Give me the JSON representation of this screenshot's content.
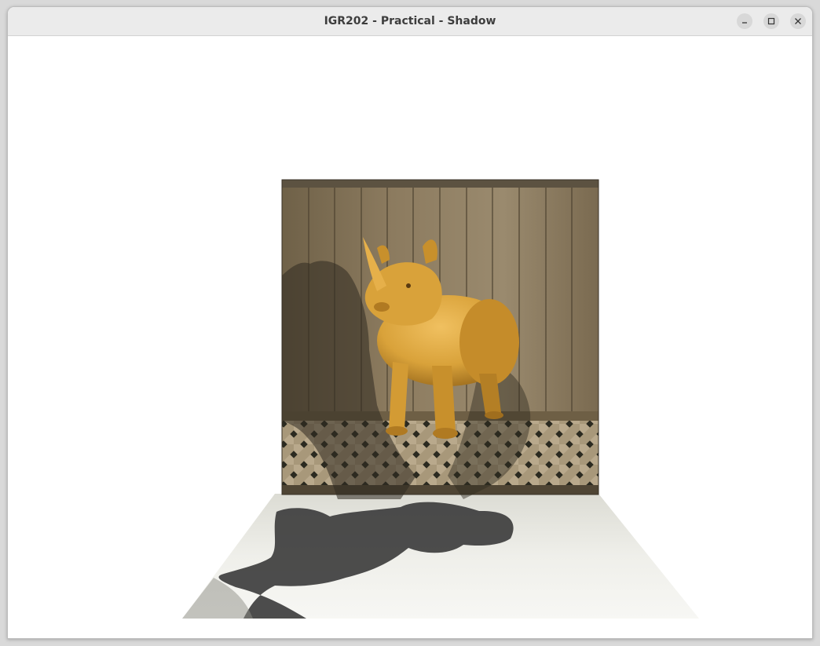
{
  "window": {
    "title": "IGR202 - Practical - Shadow",
    "controls": [
      "minimize",
      "maximize",
      "close"
    ]
  },
  "viewport": {
    "background": "#ffffff",
    "scene": {
      "objects": [
        "rhino-model",
        "wooden-fence-wall",
        "floor-plane",
        "rhino-shadow"
      ],
      "rhino_color": "#d9a23a",
      "wall_color": "#8a7a60",
      "shadow_color": "#3c3c3c"
    }
  }
}
